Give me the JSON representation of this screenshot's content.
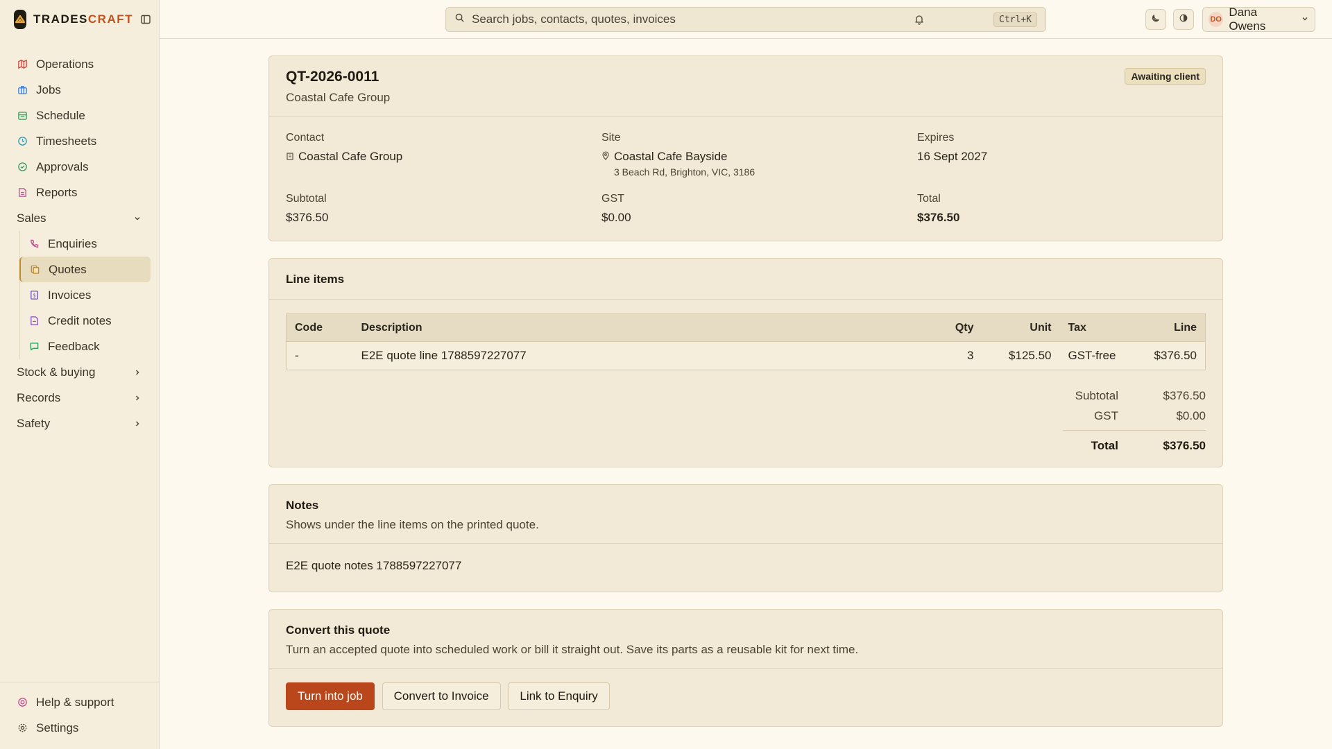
{
  "brand": {
    "name_part1": "TRADES",
    "name_part2": "CRAFT"
  },
  "sidebar": {
    "items": [
      {
        "label": "Operations",
        "icon": "map-icon",
        "color": "#d0463c"
      },
      {
        "label": "Jobs",
        "icon": "briefcase-icon",
        "color": "#3a7bd5"
      },
      {
        "label": "Schedule",
        "icon": "calendar-icon",
        "color": "#2f9d5b"
      },
      {
        "label": "Timesheets",
        "icon": "clock-icon",
        "color": "#2a9bb0"
      },
      {
        "label": "Approvals",
        "icon": "check-circle-icon",
        "color": "#2f9d5b"
      },
      {
        "label": "Reports",
        "icon": "report-icon",
        "color": "#c04b8f"
      }
    ],
    "sales_group": "Sales",
    "sales_items": [
      {
        "label": "Enquiries",
        "icon": "phone-icon",
        "color": "#c04b8f"
      },
      {
        "label": "Quotes",
        "icon": "quote-icon",
        "color": "#c0892a",
        "active": true
      },
      {
        "label": "Invoices",
        "icon": "invoice-icon",
        "color": "#6b4fc4"
      },
      {
        "label": "Credit notes",
        "icon": "credit-note-icon",
        "color": "#8a4fc4"
      },
      {
        "label": "Feedback",
        "icon": "message-icon",
        "color": "#2f9d5b"
      }
    ],
    "groups": [
      "Stock & buying",
      "Records",
      "Safety"
    ],
    "bottom": [
      {
        "label": "Help & support",
        "icon": "help-icon",
        "color": "#c04b8f"
      },
      {
        "label": "Settings",
        "icon": "gear-icon",
        "color": "#4a4234"
      }
    ]
  },
  "topbar": {
    "search_placeholder": "Search jobs, contacts, quotes, invoices",
    "search_shortcut": "Ctrl+K",
    "user_initials": "DO",
    "user_name": "Dana Owens"
  },
  "quote": {
    "number": "QT-2026-0011",
    "client": "Coastal Cafe Group",
    "status": "Awaiting client",
    "contact_label": "Contact",
    "contact": "Coastal Cafe Group",
    "site_label": "Site",
    "site": "Coastal Cafe Bayside",
    "site_address": "3 Beach Rd, Brighton, VIC, 3186",
    "expires_label": "Expires",
    "expires": "16 Sept 2027",
    "subtotal_label": "Subtotal",
    "subtotal": "$376.50",
    "gst_label": "GST",
    "gst": "$0.00",
    "total_label": "Total",
    "total": "$376.50"
  },
  "line_items": {
    "title": "Line items",
    "headers": {
      "code": "Code",
      "description": "Description",
      "qty": "Qty",
      "unit": "Unit",
      "tax": "Tax",
      "line": "Line"
    },
    "rows": [
      {
        "code": "-",
        "description": "E2E quote line 1788597227077",
        "qty": "3",
        "unit": "$125.50",
        "tax": "GST-free",
        "line": "$376.50"
      }
    ],
    "subtotal_label": "Subtotal",
    "subtotal": "$376.50",
    "gst_label": "GST",
    "gst": "$0.00",
    "total_label": "Total",
    "total": "$376.50"
  },
  "notes": {
    "title": "Notes",
    "description": "Shows under the line items on the printed quote.",
    "text": "E2E quote notes 1788597227077"
  },
  "convert": {
    "title": "Convert this quote",
    "description": "Turn an accepted quote into scheduled work or bill it straight out. Save its parts as a reusable kit for next time.",
    "turn_into_job": "Turn into job",
    "convert_to_invoice": "Convert to Invoice",
    "link_to_enquiry": "Link to Enquiry"
  }
}
